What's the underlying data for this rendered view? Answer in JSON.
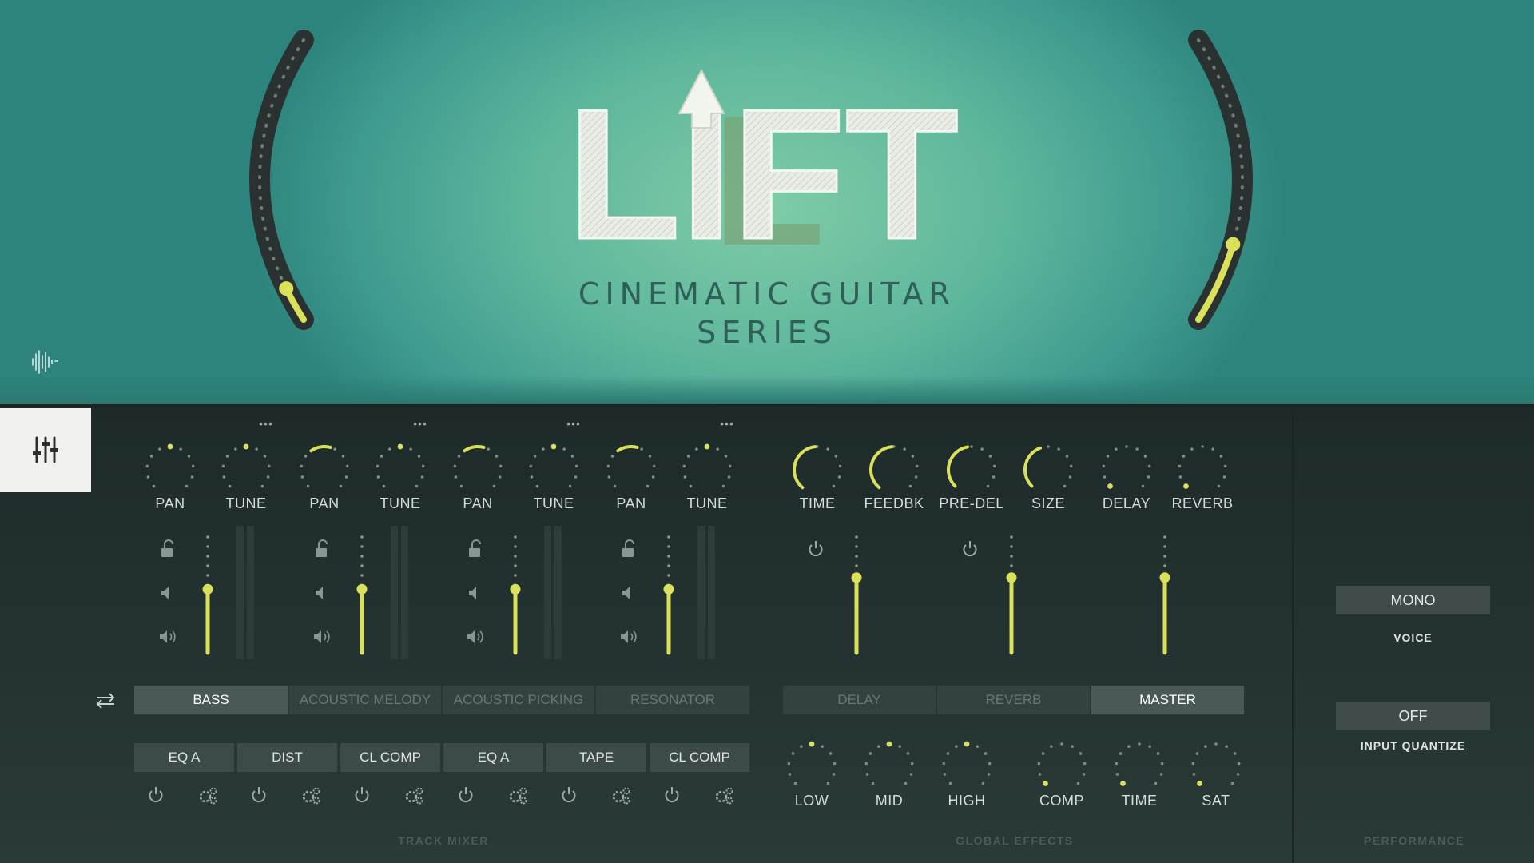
{
  "header": {
    "logo_text": "LIFT",
    "subtitle_line1": "CINEMATIC GUITAR",
    "subtitle_line2": "SERIES",
    "left_arc_level": 0.12,
    "right_arc_level": 0.28
  },
  "colors": {
    "accent": "#dbe05a",
    "panel": "#233231",
    "header": "#5fb79c"
  },
  "icons": {
    "mixer": "mixer-sliders-icon",
    "wave": "waveform-icon",
    "swap": "swap-arrows-icon"
  },
  "track_mixer": {
    "section_label": "TRACK MIXER",
    "channels": [
      {
        "pan_label": "PAN",
        "tune_label": "TUNE",
        "pan": 0.5,
        "tune": 0.5,
        "volume": 0.55
      },
      {
        "pan_label": "PAN",
        "tune_label": "TUNE",
        "pan": 0.62,
        "tune": 0.5,
        "volume": 0.55
      },
      {
        "pan_label": "PAN",
        "tune_label": "TUNE",
        "pan": 0.62,
        "tune": 0.5,
        "volume": 0.55
      },
      {
        "pan_label": "PAN",
        "tune_label": "TUNE",
        "pan": 0.58,
        "tune": 0.5,
        "volume": 0.55
      }
    ],
    "tabs": [
      {
        "label": "BASS",
        "state": "on"
      },
      {
        "label": "ACOUSTIC MELODY",
        "state": "off"
      },
      {
        "label": "ACOUSTIC PICKING",
        "state": "off"
      },
      {
        "label": "RESONATOR",
        "state": "off"
      }
    ],
    "fx_slots": [
      "EQ A",
      "DIST",
      "CL COMP",
      "EQ A",
      "TAPE",
      "CL COMP"
    ]
  },
  "global_effects": {
    "section_label": "GLOBAL EFFECTS",
    "knobs": [
      {
        "label": "TIME",
        "value": 0.62
      },
      {
        "label": "FEEDBK",
        "value": 0.62
      },
      {
        "label": "PRE-DEL",
        "value": 0.6
      },
      {
        "label": "SIZE",
        "value": 0.58
      },
      {
        "label": "DELAY",
        "value": 0.0
      },
      {
        "label": "REVERB",
        "value": 0.0
      }
    ],
    "faders": [
      0.65,
      0.65,
      0.65
    ],
    "tabs": [
      {
        "label": "DELAY",
        "state": "off"
      },
      {
        "label": "REVERB",
        "state": "off"
      },
      {
        "label": "MASTER",
        "state": "on"
      }
    ],
    "eq_knobs": [
      {
        "label": "LOW",
        "value": 0.5
      },
      {
        "label": "MID",
        "value": 0.5
      },
      {
        "label": "HIGH",
        "value": 0.5
      },
      {
        "label": "COMP",
        "value": 0.0
      },
      {
        "label": "TIME",
        "value": 0.0
      },
      {
        "label": "SAT",
        "value": 0.0
      }
    ]
  },
  "performance": {
    "section_label": "PERFORMANCE",
    "voice_value": "MONO",
    "voice_label": "VOICE",
    "quantize_value": "OFF",
    "quantize_label": "INPUT QUANTIZE"
  }
}
